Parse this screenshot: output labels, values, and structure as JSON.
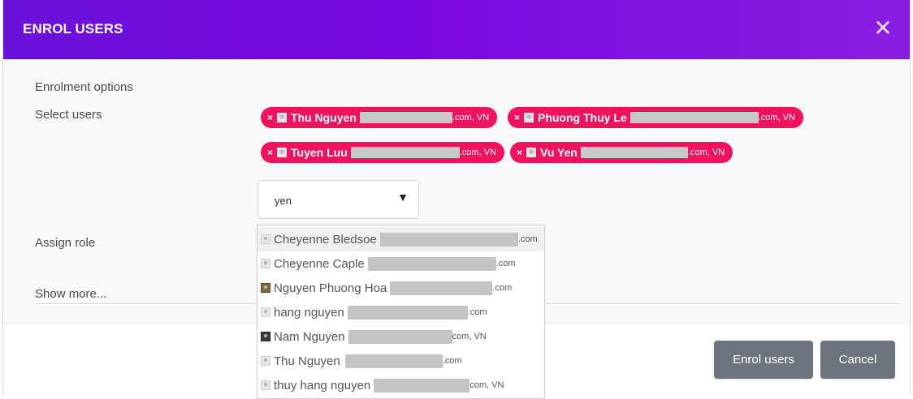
{
  "dialog": {
    "title": "ENROL USERS",
    "close_icon": "close-icon",
    "header_colors": [
      "#6a12d9",
      "#8a1ee0"
    ]
  },
  "form": {
    "enrolment_options_label": "Enrolment options",
    "select_users_label": "Select users",
    "assign_role_label": "Assign role",
    "show_more_label": "Show more..."
  },
  "selected_users": [
    {
      "name": "Thu Nguyen",
      "suffix": ".com, VN"
    },
    {
      "name": "Phuong Thuy Le",
      "suffix": ".com, VN"
    },
    {
      "name": "Tuyen Luu",
      "suffix": ".com, VN"
    },
    {
      "name": "Vu Yen",
      "suffix": ".com, VN"
    }
  ],
  "chip_remove_glyph": "×",
  "chip_color": "#f0125a",
  "search": {
    "value": "yen",
    "arrow_glyph": "▼"
  },
  "suggestions": [
    {
      "name": "Cheyenne Bledsoe",
      "suffix": ".com",
      "avatar": "default"
    },
    {
      "name": "Cheyenne Caple",
      "suffix": ".com",
      "avatar": "default"
    },
    {
      "name": "Nguyen Phuong Hoa",
      "suffix": ".com",
      "avatar": "photo"
    },
    {
      "name": "hang nguyen",
      "suffix": ".com",
      "avatar": "default"
    },
    {
      "name": "Nam Nguyen",
      "suffix": "com, VN",
      "avatar": "photo"
    },
    {
      "name": "Thu Nguyen",
      "suffix": ".com",
      "avatar": "default"
    },
    {
      "name": "thuy hang nguyen",
      "suffix": "com, VN",
      "avatar": "default"
    }
  ],
  "footer": {
    "enrol_label": "Enrol users",
    "cancel_label": "Cancel",
    "button_color": "#6c757d"
  }
}
